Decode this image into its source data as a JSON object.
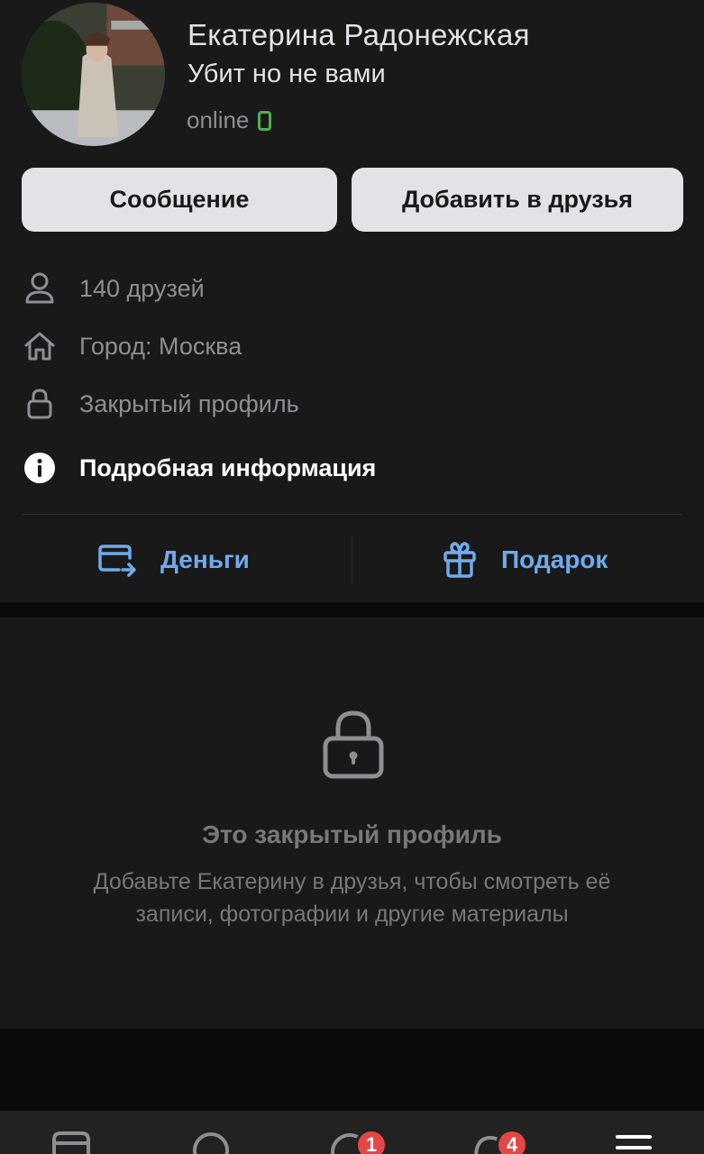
{
  "profile": {
    "name": "Екатерина Радонежская",
    "status": "Убит но не вами",
    "online": "online",
    "avatar_icon": "avatar-photo"
  },
  "actions": {
    "message_label": "Сообщение",
    "add_friend_label": "Добавить в друзья"
  },
  "info": {
    "friends": "140 друзей",
    "city": "Город: Москва",
    "closed": "Закрытый профиль",
    "details": "Подробная информация"
  },
  "quick_actions": {
    "money_label": "Деньги",
    "gift_label": "Подарок"
  },
  "locked": {
    "title": "Это закрытый профиль",
    "description": "Добавьте Екатерину в друзья, чтобы смотреть её записи, фотографии и другие материалы"
  },
  "tabbar": {
    "badges": [
      "1",
      "4"
    ],
    "icons": [
      "news-icon",
      "search-icon",
      "messages-icon",
      "notifications-icon",
      "menu-icon"
    ]
  },
  "colors": {
    "accent": "#71aaeb",
    "online": "#4bb34b",
    "badge": "#e64646",
    "card_bg": "#19191a",
    "page_bg": "#0a0a0a"
  }
}
